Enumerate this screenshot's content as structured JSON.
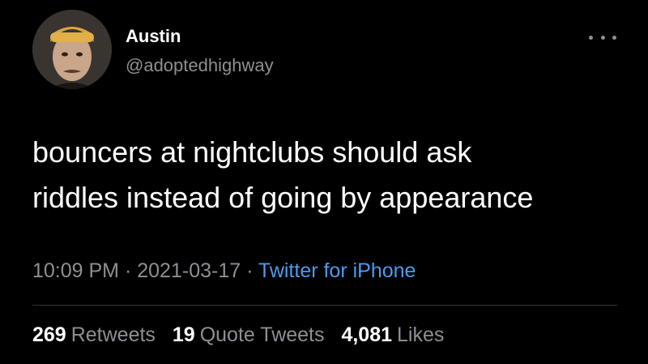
{
  "author": {
    "name": "Austin",
    "handle": "@adoptedhighway"
  },
  "tweet": {
    "lines": [
      "bouncers at nightclubs should ask",
      "riddles instead of going by appearance"
    ],
    "time": "10:09 PM",
    "separator": "·",
    "date": "2021-03-17",
    "source": "Twitter for iPhone"
  },
  "stats": {
    "retweets": {
      "count": "269",
      "label": "Retweets"
    },
    "quote_tweets": {
      "count": "19",
      "label": "Quote Tweets"
    },
    "likes": {
      "count": "4,081",
      "label": "Likes"
    }
  },
  "icons": {
    "more": "more-horizontal-icon"
  },
  "colors": {
    "background": "#000000",
    "text": "#ffffff",
    "secondary": "#8b9096",
    "link": "#4a9cf0"
  }
}
